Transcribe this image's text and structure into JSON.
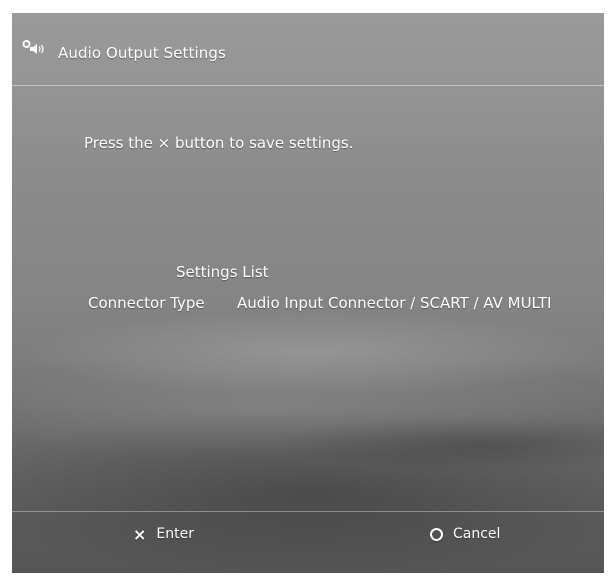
{
  "header": {
    "title": "Audio Output Settings",
    "icon": "settings-speaker-icon"
  },
  "main": {
    "instruction": "Press the × button to save settings.",
    "settings_list": {
      "heading": "Settings List",
      "rows": [
        {
          "label": "Connector Type",
          "value": "Audio Input Connector / SCART / AV MULTI"
        }
      ]
    }
  },
  "footer": {
    "enter": {
      "glyph": "×",
      "label": "Enter",
      "icon": "cross-button-icon"
    },
    "cancel": {
      "label": "Cancel",
      "icon": "circle-button-icon"
    }
  },
  "colors": {
    "text": "#ffffff",
    "background_top": "#9a9a9a",
    "background_bottom": "#555555"
  }
}
